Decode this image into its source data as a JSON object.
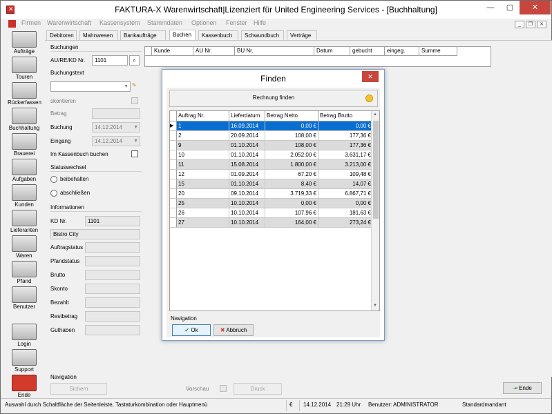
{
  "window": {
    "title": "FAKTURA-X Warenwirtschaft|Lizenziert für United Engineering Services - [Buchhaltung]",
    "min_glyph": "—",
    "max_glyph": "▢",
    "close_glyph": "✕"
  },
  "menu": {
    "items": [
      "Firmen",
      "Warenwirtschaft",
      "Kassensystem",
      "Stammdaten",
      "Optionen",
      "Fenster",
      "Hilfe"
    ]
  },
  "sidebar": {
    "items": [
      {
        "label": "Aufträge",
        "icon": "clipboard-icon"
      },
      {
        "label": "Touren",
        "icon": "truck-icon"
      },
      {
        "label": "Rückerfassen",
        "icon": "truck-return-icon"
      },
      {
        "label": "Buchhaltung",
        "icon": "calculator-icon"
      },
      {
        "label": "Brauerei",
        "icon": "brewery-icon"
      },
      {
        "label": "Aufgaben",
        "icon": "tasks-icon"
      },
      {
        "label": "Kunden",
        "icon": "customers-icon"
      },
      {
        "label": "Lieferanten",
        "icon": "suppliers-icon"
      },
      {
        "label": "Waren",
        "icon": "goods-icon"
      },
      {
        "label": "Pfand",
        "icon": "deposit-icon"
      },
      {
        "label": "Benutzer",
        "icon": "user-icon"
      },
      {
        "label": "Login",
        "icon": "key-icon"
      },
      {
        "label": "Support",
        "icon": "handshake-icon"
      },
      {
        "label": "Ende",
        "icon": "power-icon"
      }
    ]
  },
  "tabs": [
    "Debitoren",
    "Mahnwesen",
    "Bankaufträge",
    "Buchen",
    "Kassenbuch",
    "Schwundbuch",
    "Verträge"
  ],
  "buchungen": {
    "section": "Buchungen",
    "au_label": "AU/RE/KD Nr.",
    "au_value": "1101",
    "text_label": "Buchungstext",
    "skontieren": "skontieren",
    "betrag_label": "Betrag",
    "buchung_label": "Buchung",
    "buchung_value": "14.12.2014",
    "eingang_label": "Eingang",
    "eingang_value": "14.12.2014",
    "kassenbuch_label": "Im Kassenbuch buchen"
  },
  "statuswechsel": {
    "section": "Statuswechsel",
    "opt1": "beibehalten",
    "opt2": "abschließen"
  },
  "informationen": {
    "section": "Informationen",
    "kd_label": "KD Nr.",
    "kd_value": "1101",
    "name_value": "Bistro City",
    "auftragstatus": "Auftragstatus",
    "pfandstatus": "Pfandstatus",
    "brutto": "Brutto",
    "skonto": "Skonto",
    "bezahlt": "Bezahlt",
    "restbetrag": "Restbetrag",
    "guthaben": "Guthaben"
  },
  "main_grid": {
    "columns": [
      "Kunde",
      "AU Nr.",
      "BU Nr.",
      "Datum",
      "gebucht",
      "eingeg.",
      "Summe"
    ]
  },
  "bottom_nav": {
    "title": "Navigation",
    "sichern": "Sichern",
    "vorschau": "Vorschau",
    "druck": "Druck",
    "ende": "Ende"
  },
  "statusbar": {
    "message": "Auswahl durch Schaltfläche der Seitenleiste, Tastaturkombination oder Hauptmenü",
    "currency": "€",
    "date": "14.12.2014",
    "time": "21:29 Uhr",
    "user": "Benutzer: ADMINISTRATOR",
    "mandant": "Standardmandant"
  },
  "dialog": {
    "title": "Finden",
    "close_glyph": "✕",
    "header": "Rechnung finden",
    "columns": [
      "Auftrag Nr.",
      "Lieferdatum",
      "Betrag Netto",
      "Betrag Brutto"
    ],
    "rows": [
      [
        "1",
        "16.09.2014",
        "0,00 €",
        "0,00 €"
      ],
      [
        "2",
        "20.09.2014",
        "108,00 €",
        "177,36 €"
      ],
      [
        "9",
        "01.10.2014",
        "108,00 €",
        "177,36 €"
      ],
      [
        "10",
        "01.10.2014",
        "2.052,00 €",
        "3.631,17 €"
      ],
      [
        "11",
        "15.08.2014",
        "1.800,00 €",
        "3.213,00 €"
      ],
      [
        "12",
        "01.09.2014",
        "67,20 €",
        "109,48 €"
      ],
      [
        "15",
        "01.10.2014",
        "8,40 €",
        "14,07 €"
      ],
      [
        "20",
        "09.10.2014",
        "3.719,33 €",
        "6.867,71 €"
      ],
      [
        "25",
        "10.10.2014",
        "0,00 €",
        "0,00 €"
      ],
      [
        "26",
        "10.10.2014",
        "107,96 €",
        "181,63 €"
      ],
      [
        "27",
        "10.10.2014",
        "164,00 €",
        "273,24 €"
      ]
    ],
    "nav_title": "Navigation",
    "ok": "Ok",
    "abbruch": "Abbruch"
  },
  "colors": {
    "selection": "#0a6ed1",
    "close_red": "#c7463d",
    "alt_row": "#dcdcdc"
  }
}
